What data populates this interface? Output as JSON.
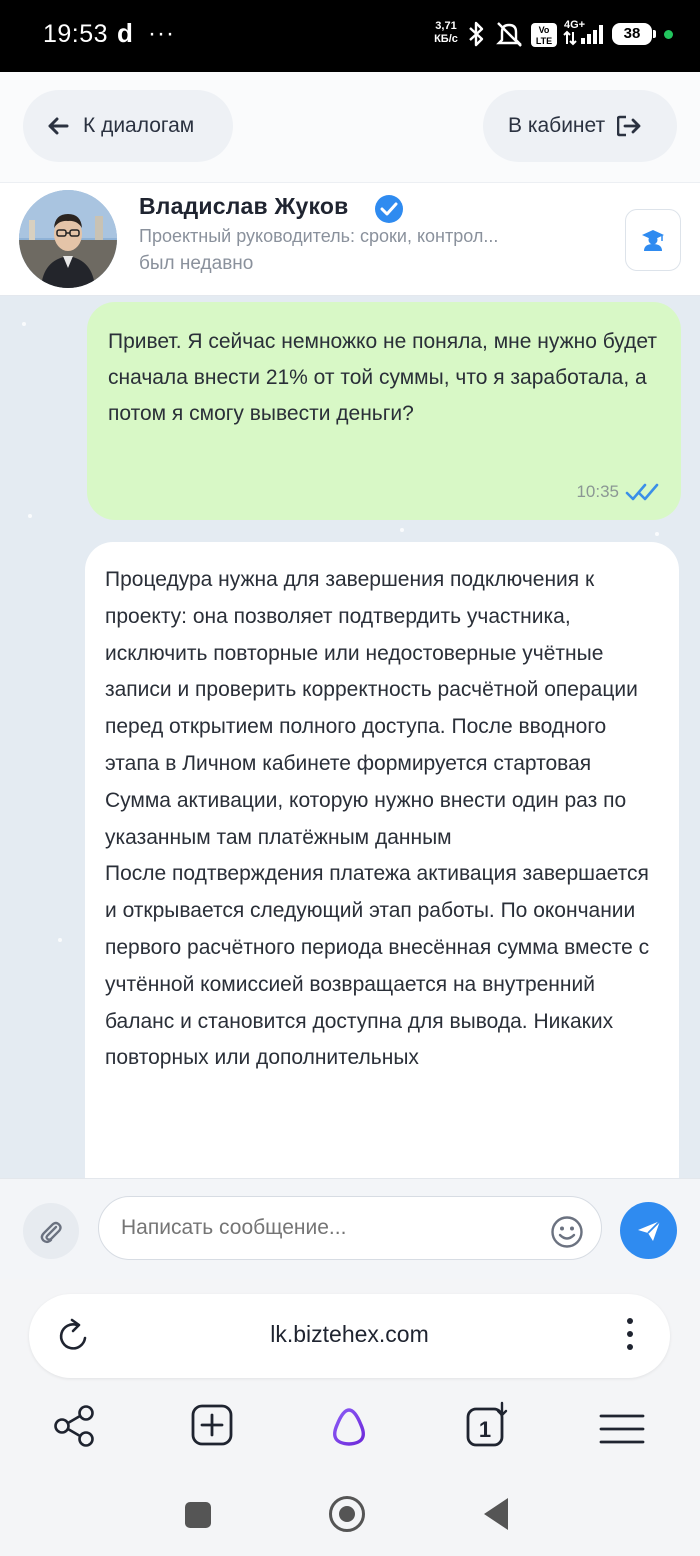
{
  "status_bar": {
    "time": "19:53",
    "app_letter": "d",
    "overflow": "···",
    "net_speed_value": "3,71",
    "net_speed_unit": "КБ/с",
    "battery": "38"
  },
  "topnav": {
    "back_label": "К диалогам",
    "cabinet_label": "В кабинет"
  },
  "contact": {
    "name": "Владислав Жуков",
    "role": "Проектный руководитель: сроки, контрол...",
    "last_seen": "был недавно"
  },
  "messages": [
    {
      "direction": "outgoing",
      "text": "Привет. Я сейчас немножко не поняла, мне нужно будет сначала внести 21% от той суммы, что я заработала, а потом я смогу вывести деньги?",
      "time": "10:35",
      "status": "read"
    },
    {
      "direction": "incoming",
      "text": "Процедура нужна для завершения подключения к проекту: она позволяет подтвердить участника, исключить повторные или недостоверные учётные записи и проверить корректность расчётной операции перед открытием полного доступа. После вводного этапа в Личном кабинете формируется стартовая Сумма активации, которую нужно внести один раз по указанным там платёжным данным\nПосле подтверждения платежа активация завершается и открывается следующий этап работы. По окончании первого расчётного периода внесённая сумма вместе с учтённой комиссией возвращается на внутренний баланс и становится доступна для вывода. Никаких повторных или дополнительных"
    }
  ],
  "composer": {
    "placeholder": "Написать сообщение..."
  },
  "browser": {
    "url": "lk.biztehex.com"
  },
  "icons": {
    "back": "arrow-left-icon",
    "cabinet": "logout-arrow-icon",
    "verified": "verified-check-icon",
    "tutor": "graduate-icon",
    "attach": "paperclip-icon",
    "emoji": "smiley-icon",
    "send": "paper-plane-icon",
    "reload": "reload-icon",
    "menu": "kebab-menu-icon",
    "share": "share-icon",
    "new_tab": "plus-square-icon",
    "assistant": "alice-icon",
    "tabs": "tabs-count-icon",
    "hamburger": "hamburger-icon"
  },
  "colors": {
    "outgoing_bubble": "#d8f8c6",
    "incoming_bubble": "#ffffff",
    "chat_background": "#e4ebf2",
    "accent": "#2f8bf0",
    "read_ticks": "#3b8fe8"
  }
}
